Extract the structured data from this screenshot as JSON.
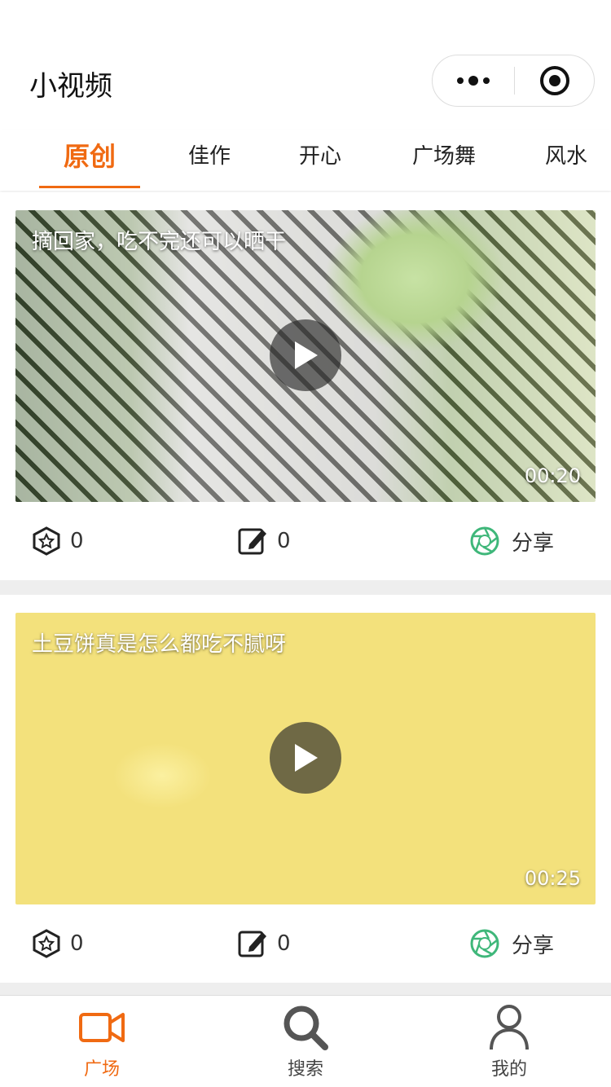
{
  "app": {
    "title": "小视频"
  },
  "tabs": [
    {
      "label": "原创",
      "active": true
    },
    {
      "label": "佳作"
    },
    {
      "label": "开心"
    },
    {
      "label": "广场舞"
    },
    {
      "label": "风水"
    }
  ],
  "videos": [
    {
      "title": "摘回家，吃不完还可以晒干",
      "duration": "00:20",
      "likes": "0",
      "comments": "0",
      "share_label": "分享"
    },
    {
      "title": "土豆饼真是怎么都吃不腻呀",
      "duration": "00:25",
      "likes": "0",
      "comments": "0",
      "share_label": "分享"
    }
  ],
  "bottom_nav": [
    {
      "label": "广场",
      "icon": "video-camera-icon",
      "active": true
    },
    {
      "label": "搜索",
      "icon": "search-icon"
    },
    {
      "label": "我的",
      "icon": "user-icon"
    }
  ],
  "colors": {
    "accent": "#f06a12",
    "share": "#3fb77a",
    "divider": "#eeeeee"
  }
}
